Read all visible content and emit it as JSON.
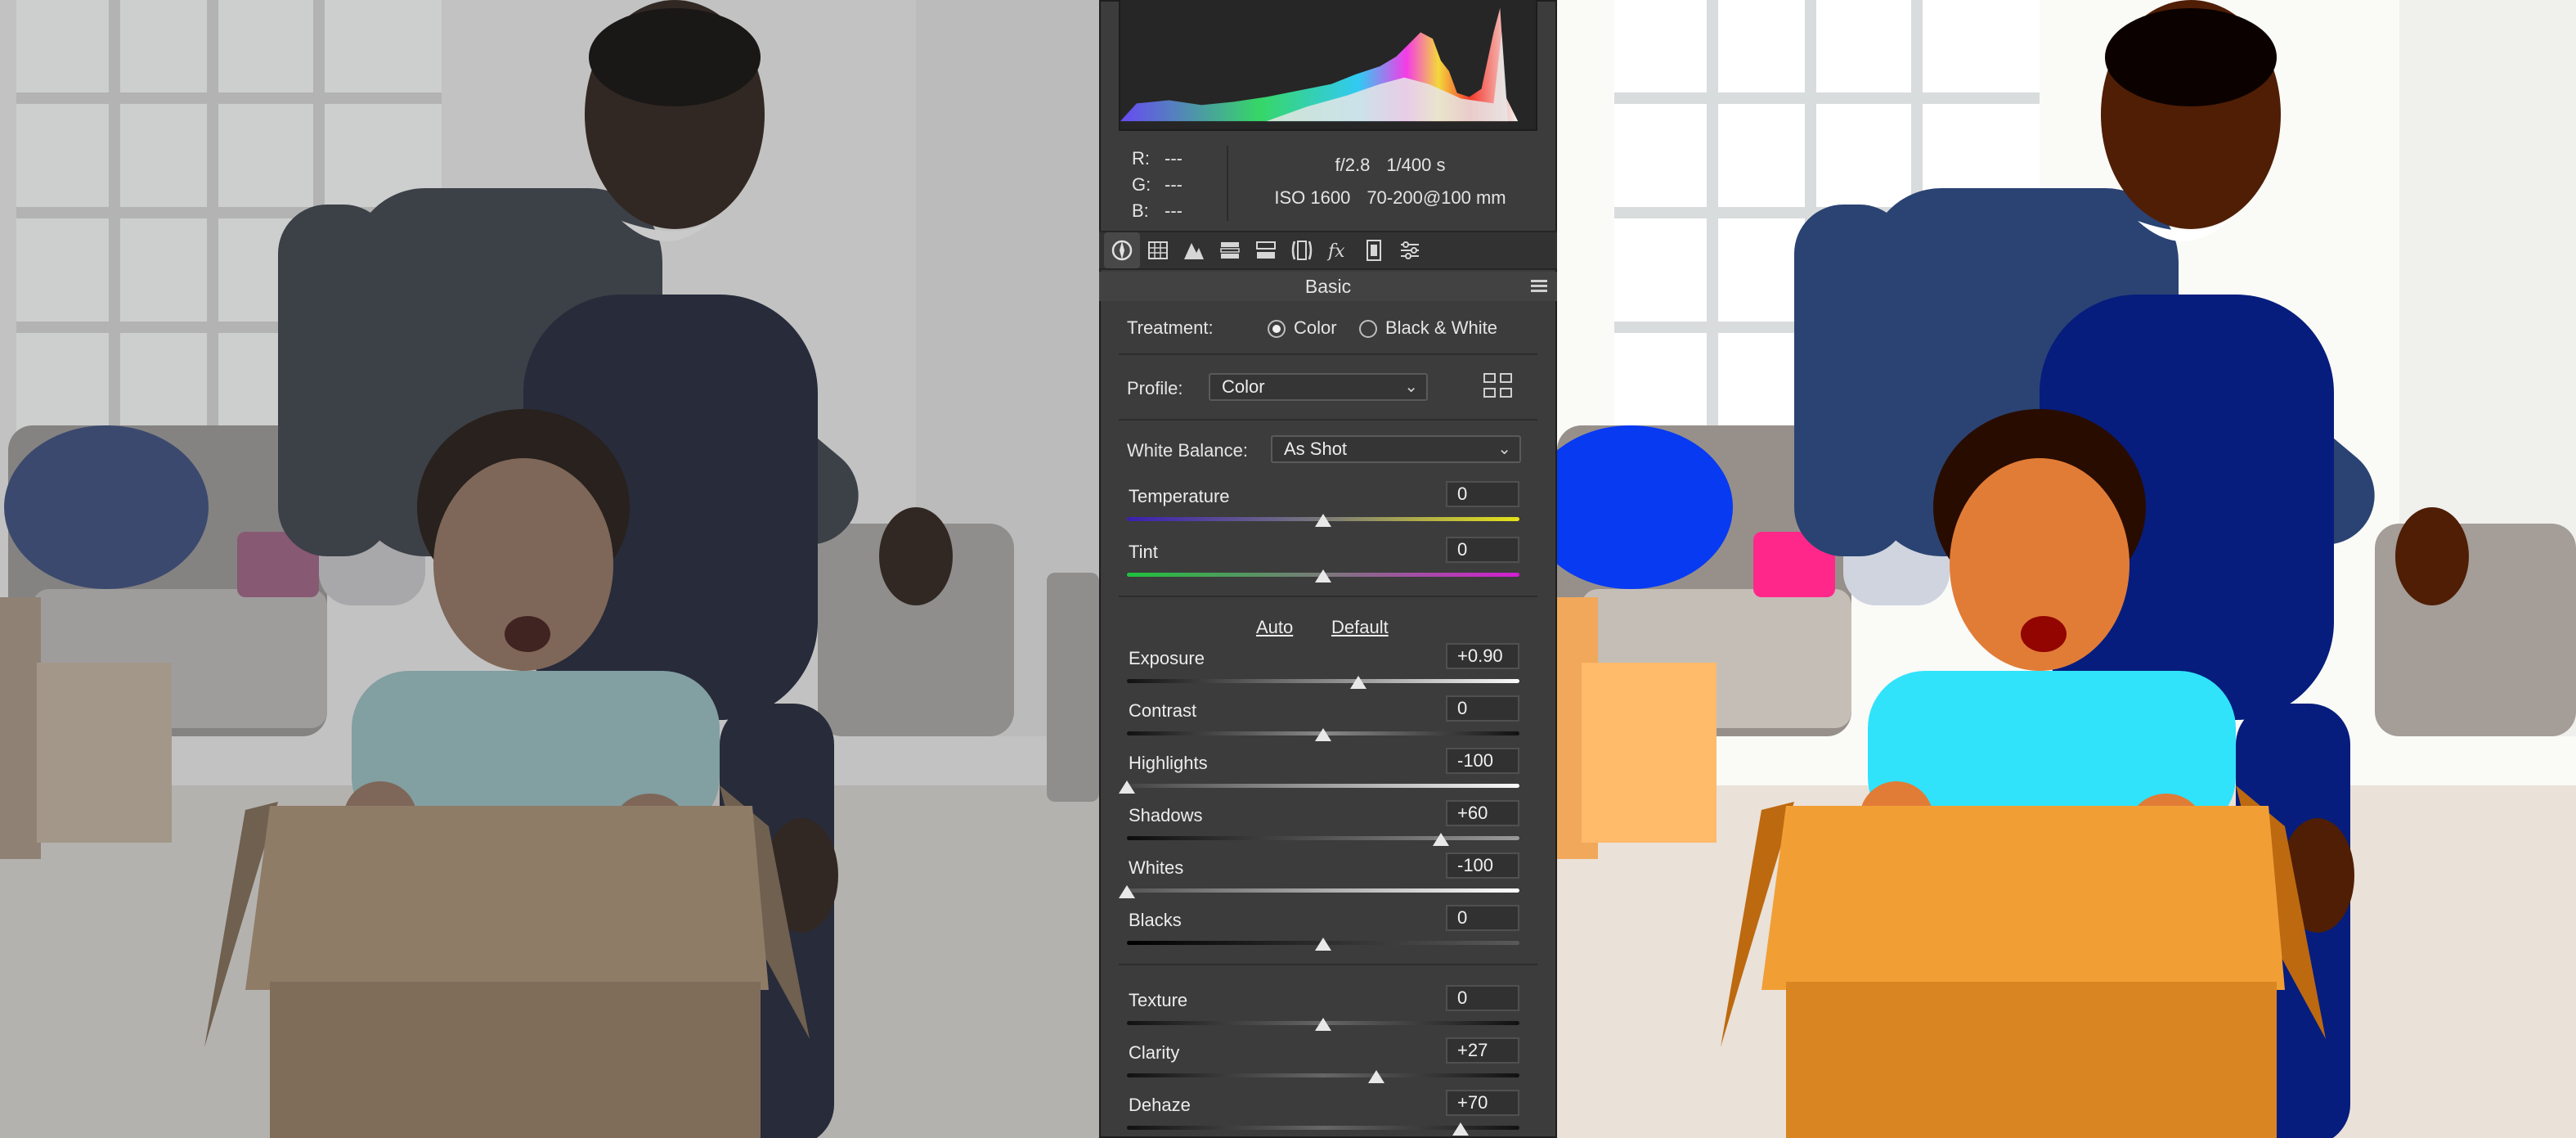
{
  "histogram": {
    "label": ""
  },
  "readout": {
    "r_label": "R:",
    "r_value": "---",
    "g_label": "G:",
    "g_value": "---",
    "b_label": "B:",
    "b_value": "---",
    "aperture": "f/2.8",
    "shutter": "1/400 s",
    "iso": "ISO 1600",
    "lens": "70-200@100 mm"
  },
  "toolbar": {
    "icons": [
      "basic-icon",
      "tone-curve-icon",
      "detail-icon",
      "hsl-icon",
      "split-toning-icon",
      "lens-corrections-icon",
      "effects-icon",
      "camera-calibration-icon",
      "presets-icon"
    ]
  },
  "section": {
    "title": "Basic"
  },
  "treatment": {
    "label": "Treatment:",
    "color": "Color",
    "bw": "Black & White",
    "selected": "Color"
  },
  "profile": {
    "label": "Profile:",
    "value": "Color"
  },
  "white_balance": {
    "label": "White Balance:",
    "value": "As Shot"
  },
  "links": {
    "auto": "Auto",
    "default": "Default"
  },
  "sliders": {
    "temperature": {
      "label": "Temperature",
      "value": "0",
      "pos": 0.5
    },
    "tint": {
      "label": "Tint",
      "value": "0",
      "pos": 0.5
    },
    "exposure": {
      "label": "Exposure",
      "value": "+0.90",
      "pos": 0.59
    },
    "contrast": {
      "label": "Contrast",
      "value": "0",
      "pos": 0.5
    },
    "highlights": {
      "label": "Highlights",
      "value": "-100",
      "pos": 0.0
    },
    "shadows": {
      "label": "Shadows",
      "value": "+60",
      "pos": 0.8
    },
    "whites": {
      "label": "Whites",
      "value": "-100",
      "pos": 0.0
    },
    "blacks": {
      "label": "Blacks",
      "value": "0",
      "pos": 0.5
    },
    "texture": {
      "label": "Texture",
      "value": "0",
      "pos": 0.5
    },
    "clarity": {
      "label": "Clarity",
      "value": "+27",
      "pos": 0.635
    },
    "dehaze": {
      "label": "Dehaze",
      "value": "+70",
      "pos": 0.85
    }
  },
  "colors": {
    "panel": "#3c3c3c",
    "accent": "#e8e8e8"
  }
}
